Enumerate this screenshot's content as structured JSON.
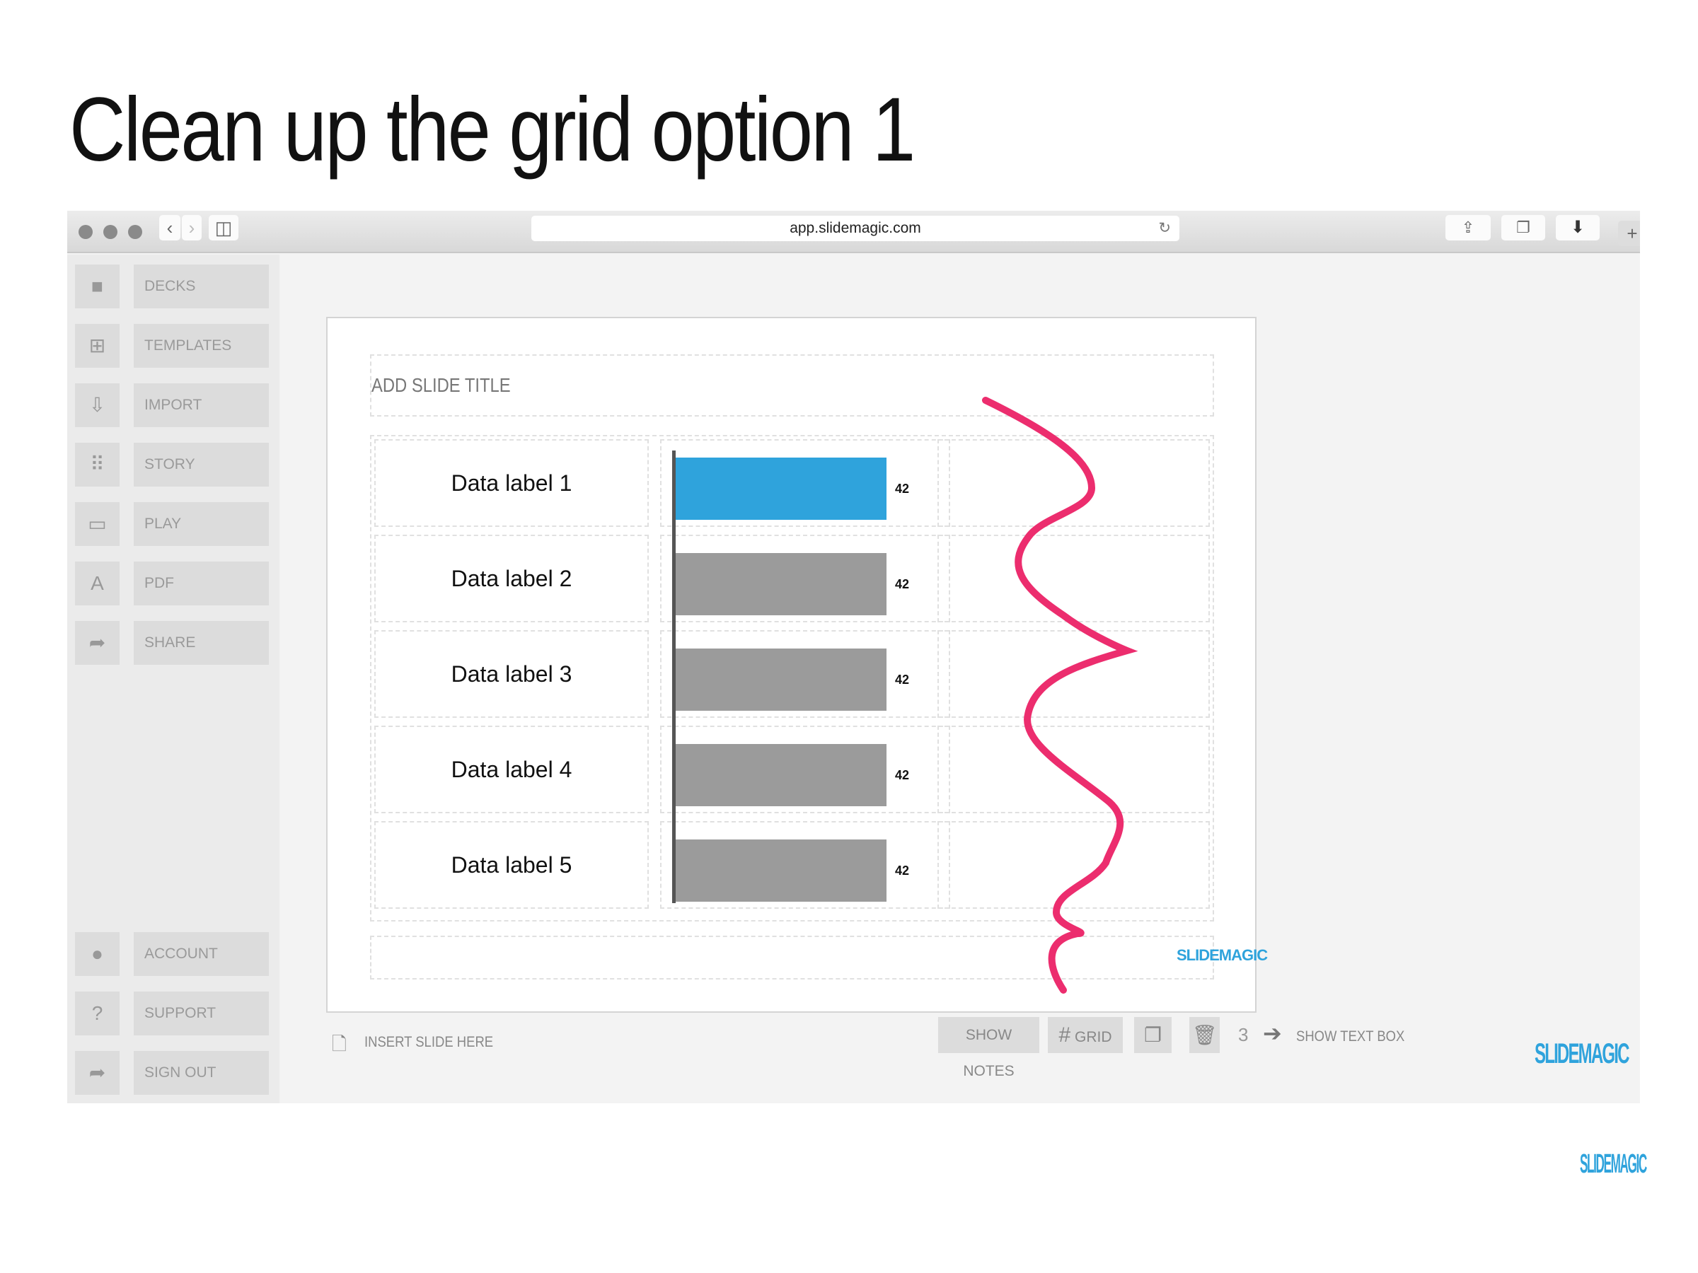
{
  "title": "Clean up the grid option 1",
  "browser": {
    "url": "app.slidemagic.com"
  },
  "sidebar": {
    "items": [
      {
        "label": "DECKS",
        "icon": "folder-icon"
      },
      {
        "label": "TEMPLATES",
        "icon": "gift-icon"
      },
      {
        "label": "IMPORT",
        "icon": "cloud-download-icon"
      },
      {
        "label": "STORY",
        "icon": "grid-icon"
      },
      {
        "label": "PLAY",
        "icon": "monitor-icon"
      },
      {
        "label": "PDF",
        "icon": "pdf-icon"
      },
      {
        "label": "SHARE",
        "icon": "share-arrow-icon"
      }
    ],
    "bottom": [
      {
        "label": "ACCOUNT",
        "icon": "user-icon"
      },
      {
        "label": "SUPPORT",
        "icon": "help-icon"
      },
      {
        "label": "SIGN OUT",
        "icon": "sign-out-icon"
      }
    ]
  },
  "slide": {
    "title_placeholder": "ADD SLIDE TITLE",
    "rows": [
      {
        "label": "Data label 1",
        "value": "42"
      },
      {
        "label": "Data label 2",
        "value": "42"
      },
      {
        "label": "Data label 3",
        "value": "42"
      },
      {
        "label": "Data label 4",
        "value": "42"
      },
      {
        "label": "Data label 5",
        "value": "42"
      }
    ],
    "highlight_color": "#2fa3dc",
    "bar_color": "#9b9b9b",
    "annotation_color": "#ec2d6e",
    "logo": "SLIDEMAGIC"
  },
  "bottom_bar": {
    "insert_slide": "INSERT SLIDE HERE",
    "show_notes": "SHOW NOTES",
    "grid": "GRID",
    "page": "3",
    "show_text_box": "SHOW TEXT BOX"
  },
  "logo": "SLIDEMAGIC"
}
